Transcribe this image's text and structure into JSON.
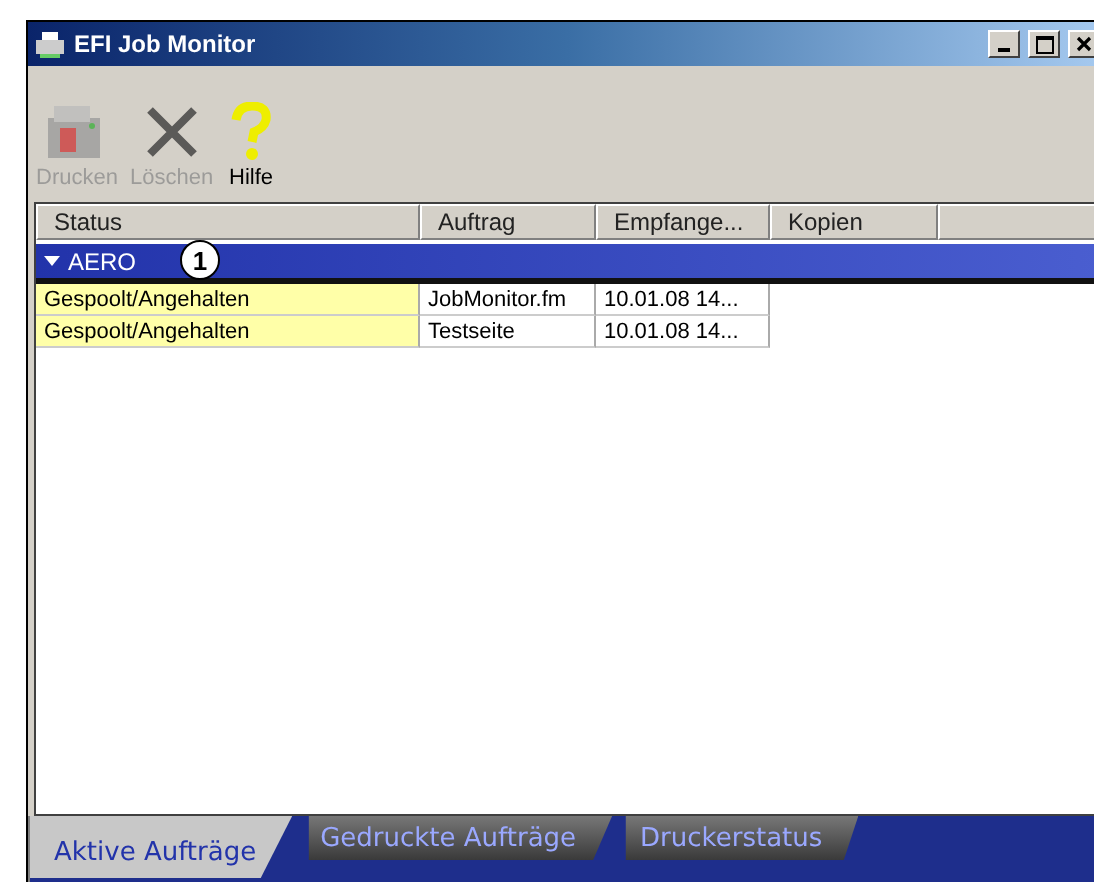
{
  "window": {
    "title": "EFI Job Monitor"
  },
  "toolbar": [
    {
      "label": "Drucken",
      "kind": "printer",
      "disabled": true
    },
    {
      "label": "Löschen",
      "kind": "delete",
      "disabled": true
    },
    {
      "label": "Hilfe",
      "kind": "help",
      "disabled": false
    }
  ],
  "table": {
    "columns": [
      "Status",
      "Auftrag",
      "Empfange...",
      "Kopien"
    ],
    "group": {
      "label": "AERO",
      "expanded": true,
      "callout": "1"
    },
    "rows": [
      {
        "cells": [
          "Gespoolt/Angehalten",
          "JobMonitor.fm",
          "10.01.08  14...",
          ""
        ]
      },
      {
        "cells": [
          "Gespoolt/Angehalten",
          "Testseite",
          "10.01.08  14...",
          ""
        ]
      }
    ]
  },
  "tabs": [
    {
      "label": "Aktive Aufträge",
      "selected": true
    },
    {
      "label": "Gedruckte Aufträge",
      "selected": false
    },
    {
      "label": "Druckerstatus",
      "selected": false
    }
  ]
}
